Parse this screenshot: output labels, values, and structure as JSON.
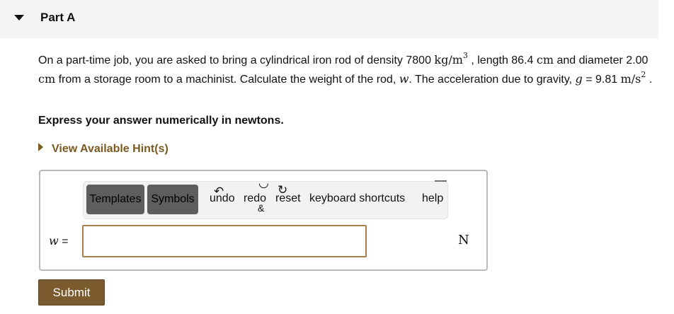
{
  "part": {
    "title": "Part A"
  },
  "question": {
    "t1": "On a part-time job, you are asked to bring a cylindrical iron rod of density 7800 ",
    "density_unit": "kg/m",
    "density_exp": "3",
    "t2": " , length 86.4 ",
    "length_unit": "cm",
    "t3": " and diameter 2.00 ",
    "diam_unit": "cm",
    "t4": " from a storage room to a machinist. Calculate the weight of the rod, ",
    "weight_var": "w",
    "t5": ". The acceleration due to gravity, ",
    "g_var": "g",
    "t6": " = 9.81 ",
    "g_unit": "m/s",
    "g_exp": "2",
    "t7": " ."
  },
  "instruction": "Express your answer numerically in newtons.",
  "hint_link": "View Available Hint(s)",
  "toolbar": {
    "templates": "Templates",
    "symbols": "Symbols",
    "undo": "undo",
    "redo": "redo",
    "reset": "reset",
    "keyboard_shortcuts": "keyboard shortcuts",
    "help": "help",
    "amp": "&"
  },
  "answer": {
    "label": "w =",
    "value": "",
    "unit": "N"
  },
  "submit_label": "Submit"
}
